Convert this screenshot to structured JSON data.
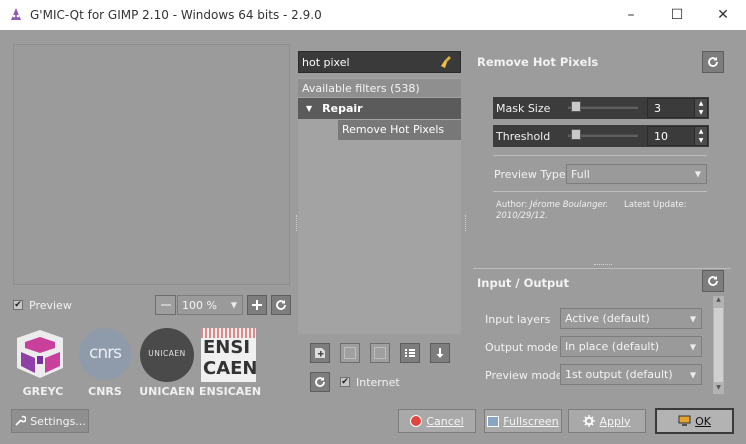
{
  "window": {
    "title": "G'MIC-Qt for GIMP 2.10 - Windows 64 bits - 2.9.0",
    "minimize_glyph": "–",
    "maximize_glyph": "☐",
    "close_glyph": "✕"
  },
  "preview": {
    "checkbox_label": "Preview",
    "checked": true,
    "zoom_value": "100 %"
  },
  "logos": [
    {
      "name": "GREYC"
    },
    {
      "name": "CNRS",
      "mark": "cnrs"
    },
    {
      "name": "UNICAEN",
      "mark": "UNICAEN"
    },
    {
      "name": "ENSICAEN",
      "mark_top": "ENSI",
      "mark_bottom": "CAEN"
    }
  ],
  "settings_button": "Settings...",
  "filters": {
    "search_value": "hot pixel",
    "available_label": "Available filters (538)",
    "category": "Repair",
    "selected_filter": "Remove Hot Pixels",
    "internet_label": "Internet",
    "internet_checked": true
  },
  "params": {
    "title": "Remove Hot Pixels",
    "mask_size": {
      "label": "Mask Size",
      "value": "3",
      "slider_fraction": 0.05
    },
    "threshold": {
      "label": "Threshold",
      "value": "10",
      "slider_fraction": 0.05
    },
    "preview_type": {
      "label": "Preview Type",
      "value": "Full"
    },
    "author_label": "Author:",
    "author_name": "Jérome Boulanger.",
    "update_label": "Latest Update:",
    "update_date": "2010/29/12."
  },
  "io": {
    "title": "Input / Output",
    "input_layers": {
      "label": "Input layers",
      "value": "Active (default)"
    },
    "output_mode": {
      "label": "Output mode",
      "value": "In place (default)"
    },
    "preview_mode": {
      "label": "Preview mode",
      "value": "1st output (default)"
    }
  },
  "buttons": {
    "cancel": "Cancel",
    "fullscreen": "Fullscreen",
    "apply": "Apply",
    "ok": "OK"
  }
}
